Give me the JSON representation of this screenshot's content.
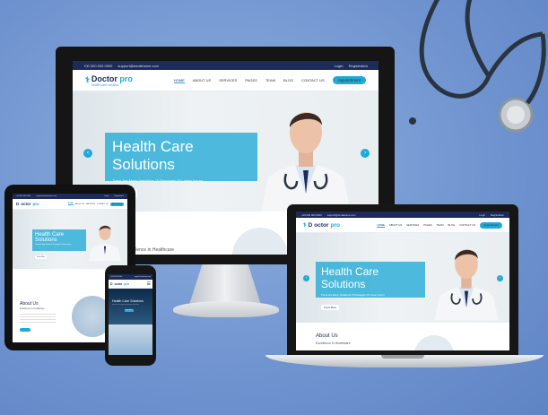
{
  "colors": {
    "navy": "#1c2b5a",
    "accent": "#1fa9d6",
    "background": "#6f93cf"
  },
  "site": {
    "phone": "+00 000 000 0000",
    "email": "support@emailname.com",
    "login": "Login",
    "registration": "Registration",
    "logo": {
      "prefix": "D",
      "word": "octor",
      "suffix": "pro",
      "tagline": "health care solution"
    },
    "menu": [
      "HOME",
      "ABOUT US",
      "SERVICES",
      "PAGES",
      "TEAM",
      "BLOG",
      "CONTACT US"
    ],
    "appointment": "Appointment",
    "hero": {
      "title": "Health Care Solutions",
      "subtitle": "There Are Many Variations Of Passages Of Lorem Ipsum",
      "button": "Know More"
    },
    "about": {
      "title": "About Us",
      "subtitle": "Excellence in Healthcare"
    }
  }
}
